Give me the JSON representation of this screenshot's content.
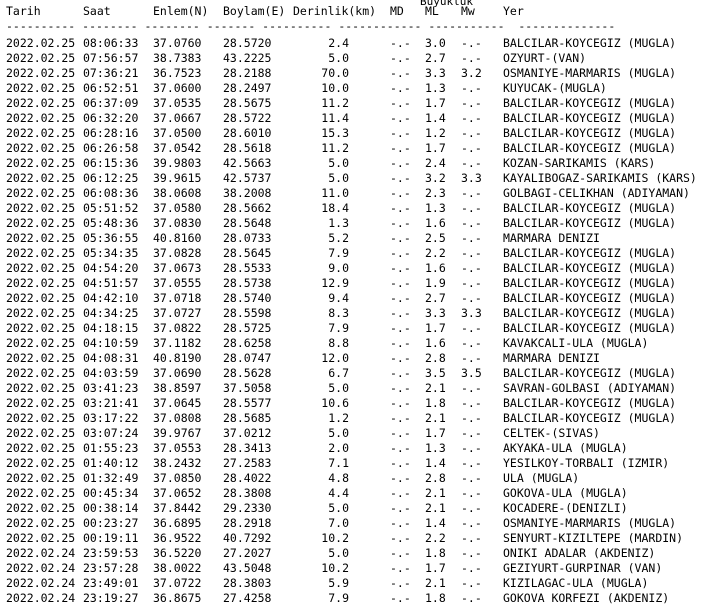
{
  "super_header": "Buyukluk",
  "headers": [
    "Tarih",
    "Saat",
    "Enlem(N)",
    "Boylam(E)",
    "Derinlik(km)",
    "MD",
    "ML",
    "Mw",
    "Yer"
  ],
  "separator": "---------- -------- -------- ------- ---------- ------------ -----------  --------------",
  "rows": [
    [
      "2022.02.25",
      "08:06:33",
      "37.0760",
      "28.5720",
      "2.4",
      "-.-",
      "3.0",
      "-.-",
      "BALCILAR-KOYCEGIZ (MUGLA)"
    ],
    [
      "2022.02.25",
      "07:56:57",
      "38.7383",
      "43.2225",
      "5.0",
      "-.-",
      "2.7",
      "-.-",
      "OZYURT-(VAN)"
    ],
    [
      "2022.02.25",
      "07:36:21",
      "36.7523",
      "28.2188",
      "70.0",
      "-.-",
      "3.3",
      "3.2",
      "OSMANIYE-MARMARIS (MUGLA)"
    ],
    [
      "2022.02.25",
      "06:52:51",
      "37.0600",
      "28.2497",
      "10.0",
      "-.-",
      "1.3",
      "-.-",
      "KUYUCAK-(MUGLA)"
    ],
    [
      "2022.02.25",
      "06:37:09",
      "37.0535",
      "28.5675",
      "11.2",
      "-.-",
      "1.7",
      "-.-",
      "BALCILAR-KOYCEGIZ (MUGLA)"
    ],
    [
      "2022.02.25",
      "06:32:20",
      "37.0667",
      "28.5722",
      "11.4",
      "-.-",
      "1.4",
      "-.-",
      "BALCILAR-KOYCEGIZ (MUGLA)"
    ],
    [
      "2022.02.25",
      "06:28:16",
      "37.0500",
      "28.6010",
      "15.3",
      "-.-",
      "1.2",
      "-.-",
      "BALCILAR-KOYCEGIZ (MUGLA)"
    ],
    [
      "2022.02.25",
      "06:26:58",
      "37.0542",
      "28.5618",
      "11.2",
      "-.-",
      "1.7",
      "-.-",
      "BALCILAR-KOYCEGIZ (MUGLA)"
    ],
    [
      "2022.02.25",
      "06:15:36",
      "39.9803",
      "42.5663",
      "5.0",
      "-.-",
      "2.4",
      "-.-",
      "KOZAN-SARIKAMIS (KARS)"
    ],
    [
      "2022.02.25",
      "06:12:25",
      "39.9615",
      "42.5737",
      "5.0",
      "-.-",
      "3.2",
      "3.3",
      "KAYALIBOGAZ-SARIKAMIS (KARS)"
    ],
    [
      "2022.02.25",
      "06:08:36",
      "38.0608",
      "38.2008",
      "11.0",
      "-.-",
      "2.3",
      "-.-",
      "GOLBAGI-CELIKHAN (ADIYAMAN)"
    ],
    [
      "2022.02.25",
      "05:51:52",
      "37.0580",
      "28.5662",
      "18.4",
      "-.-",
      "1.3",
      "-.-",
      "BALCILAR-KOYCEGIZ (MUGLA)"
    ],
    [
      "2022.02.25",
      "05:48:36",
      "37.0830",
      "28.5648",
      "1.3",
      "-.-",
      "1.6",
      "-.-",
      "BALCILAR-KOYCEGIZ (MUGLA)"
    ],
    [
      "2022.02.25",
      "05:36:55",
      "40.8160",
      "28.0733",
      "5.2",
      "-.-",
      "2.5",
      "-.-",
      "MARMARA DENIZI"
    ],
    [
      "2022.02.25",
      "05:34:35",
      "37.0828",
      "28.5645",
      "7.9",
      "-.-",
      "2.2",
      "-.-",
      "BALCILAR-KOYCEGIZ (MUGLA)"
    ],
    [
      "2022.02.25",
      "04:54:20",
      "37.0673",
      "28.5533",
      "9.0",
      "-.-",
      "1.6",
      "-.-",
      "BALCILAR-KOYCEGIZ (MUGLA)"
    ],
    [
      "2022.02.25",
      "04:51:57",
      "37.0555",
      "28.5738",
      "12.9",
      "-.-",
      "1.9",
      "-.-",
      "BALCILAR-KOYCEGIZ (MUGLA)"
    ],
    [
      "2022.02.25",
      "04:42:10",
      "37.0718",
      "28.5740",
      "9.4",
      "-.-",
      "2.7",
      "-.-",
      "BALCILAR-KOYCEGIZ (MUGLA)"
    ],
    [
      "2022.02.25",
      "04:34:25",
      "37.0727",
      "28.5598",
      "8.3",
      "-.-",
      "3.3",
      "3.3",
      "BALCILAR-KOYCEGIZ (MUGLA)"
    ],
    [
      "2022.02.25",
      "04:18:15",
      "37.0822",
      "28.5725",
      "7.9",
      "-.-",
      "1.7",
      "-.-",
      "BALCILAR-KOYCEGIZ (MUGLA)"
    ],
    [
      "2022.02.25",
      "04:10:59",
      "37.1182",
      "28.6258",
      "8.8",
      "-.-",
      "1.6",
      "-.-",
      "KAVAKCALI-ULA (MUGLA)"
    ],
    [
      "2022.02.25",
      "04:08:31",
      "40.8190",
      "28.0747",
      "12.0",
      "-.-",
      "2.8",
      "-.-",
      "MARMARA DENIZI"
    ],
    [
      "2022.02.25",
      "04:03:59",
      "37.0690",
      "28.5628",
      "6.7",
      "-.-",
      "3.5",
      "3.5",
      "BALCILAR-KOYCEGIZ (MUGLA)"
    ],
    [
      "2022.02.25",
      "03:41:23",
      "38.8597",
      "37.5058",
      "5.0",
      "-.-",
      "2.1",
      "-.-",
      "SAVRAN-GOLBASI (ADIYAMAN)"
    ],
    [
      "2022.02.25",
      "03:21:41",
      "37.0645",
      "28.5577",
      "10.6",
      "-.-",
      "1.8",
      "-.-",
      "BALCILAR-KOYCEGIZ (MUGLA)"
    ],
    [
      "2022.02.25",
      "03:17:22",
      "37.0808",
      "28.5685",
      "1.2",
      "-.-",
      "2.1",
      "-.-",
      "BALCILAR-KOYCEGIZ (MUGLA)"
    ],
    [
      "2022.02.25",
      "03:07:24",
      "39.9767",
      "37.0212",
      "5.0",
      "-.-",
      "1.7",
      "-.-",
      "CELTEK-(SIVAS)"
    ],
    [
      "2022.02.25",
      "01:55:23",
      "37.0553",
      "28.3413",
      "2.0",
      "-.-",
      "1.3",
      "-.-",
      "AKYAKA-ULA (MUGLA)"
    ],
    [
      "2022.02.25",
      "01:40:12",
      "38.2432",
      "27.2583",
      "7.1",
      "-.-",
      "1.4",
      "-.-",
      "YESILKOY-TORBALI (IZMIR)"
    ],
    [
      "2022.02.25",
      "01:32:49",
      "37.0850",
      "28.4022",
      "4.8",
      "-.-",
      "2.8",
      "-.-",
      "ULA (MUGLA)"
    ],
    [
      "2022.02.25",
      "00:45:34",
      "37.0652",
      "28.3808",
      "4.4",
      "-.-",
      "2.1",
      "-.-",
      "GOKOVA-ULA (MUGLA)"
    ],
    [
      "2022.02.25",
      "00:38:14",
      "37.8442",
      "29.2330",
      "5.0",
      "-.-",
      "2.1",
      "-.-",
      "KOCADERE-(DENIZLI)"
    ],
    [
      "2022.02.25",
      "00:23:27",
      "36.6895",
      "28.2918",
      "7.0",
      "-.-",
      "1.4",
      "-.-",
      "OSMANIYE-MARMARIS (MUGLA)"
    ],
    [
      "2022.02.25",
      "00:19:11",
      "36.9522",
      "40.7292",
      "10.2",
      "-.-",
      "2.2",
      "-.-",
      "SENYURT-KIZILTEPE (MARDIN)"
    ],
    [
      "2022.02.24",
      "23:59:53",
      "36.5220",
      "27.2027",
      "5.0",
      "-.-",
      "1.8",
      "-.-",
      "ONIKI ADALAR (AKDENIZ)"
    ],
    [
      "2022.02.24",
      "23:57:28",
      "38.0022",
      "43.5048",
      "10.2",
      "-.-",
      "1.7",
      "-.-",
      "GEZIYURT-GURPINAR (VAN)"
    ],
    [
      "2022.02.24",
      "23:49:01",
      "37.0722",
      "28.3803",
      "5.9",
      "-.-",
      "2.1",
      "-.-",
      "KIZILAGAC-ULA (MUGLA)"
    ],
    [
      "2022.02.24",
      "23:19:27",
      "36.8675",
      "27.4258",
      "7.9",
      "-.-",
      "1.8",
      "-.-",
      "GOKOVA KORFEZI (AKDENIZ)"
    ]
  ]
}
